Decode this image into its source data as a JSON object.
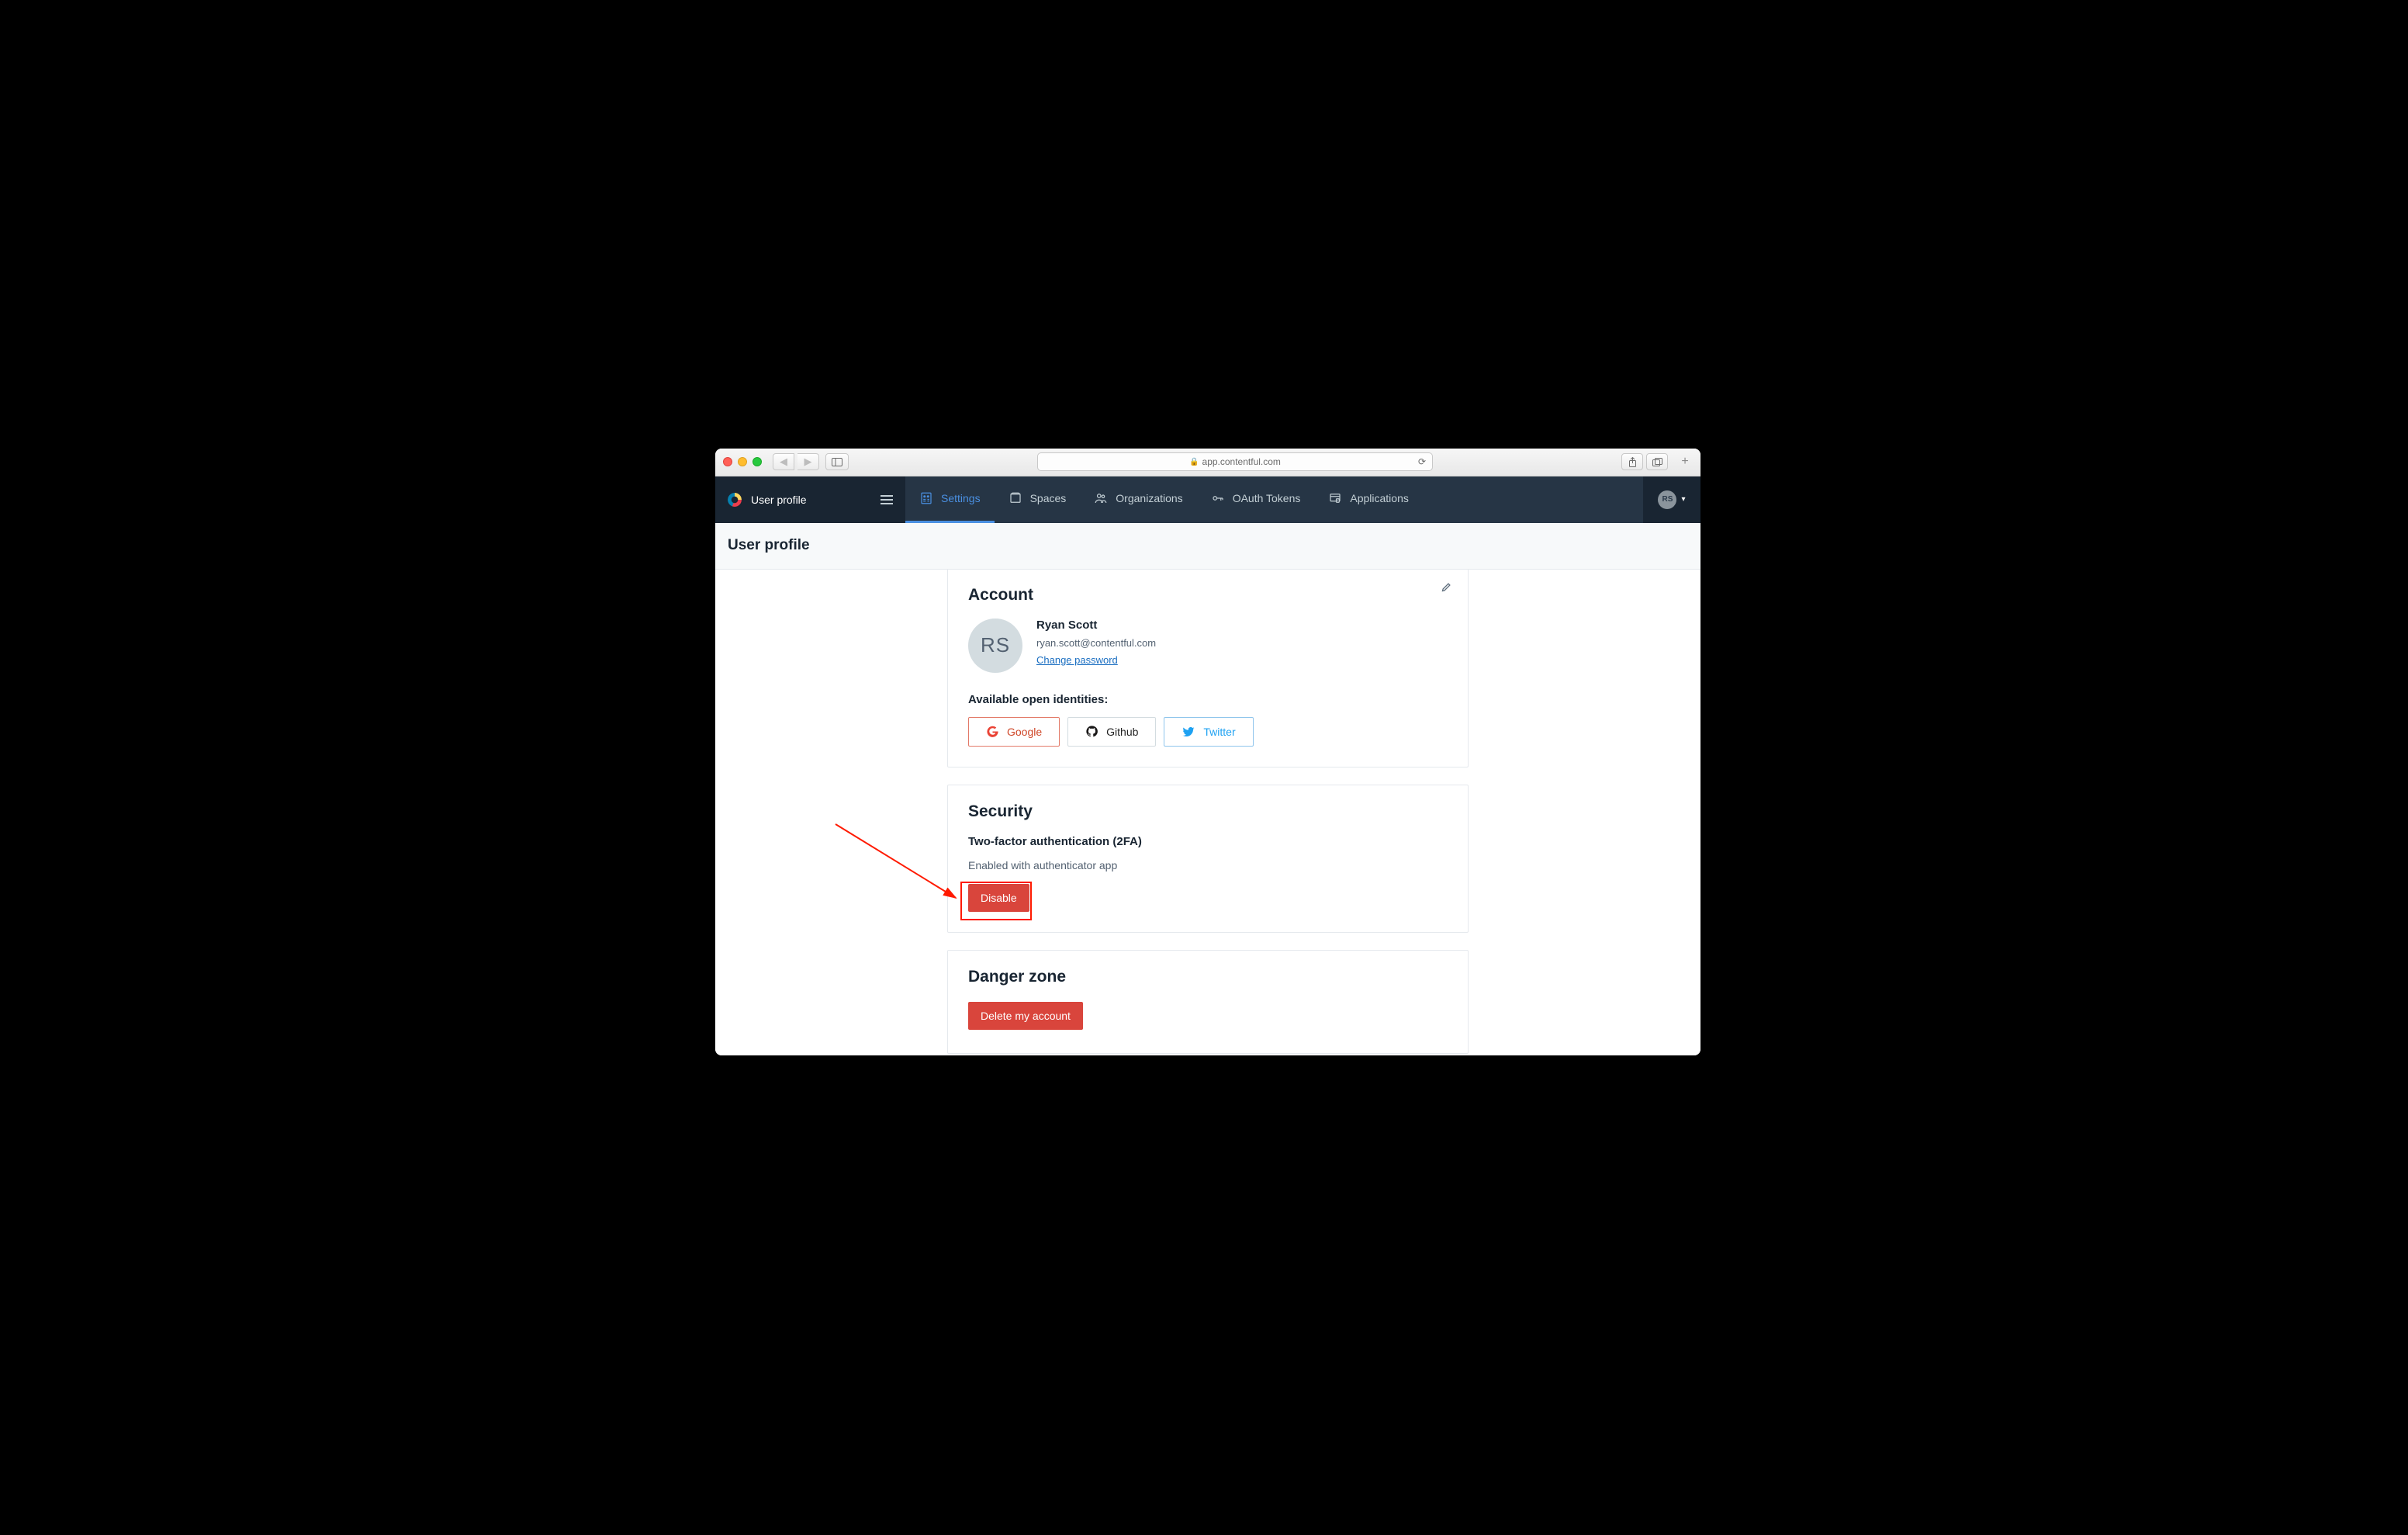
{
  "browser": {
    "url_host": "app.contentful.com"
  },
  "nav": {
    "brand_title": "User profile",
    "items": [
      {
        "label": "Settings",
        "active": true
      },
      {
        "label": "Spaces",
        "active": false
      },
      {
        "label": "Organizations",
        "active": false
      },
      {
        "label": "OAuth Tokens",
        "active": false
      },
      {
        "label": "Applications",
        "active": false
      }
    ],
    "avatar_initials": "RS"
  },
  "page": {
    "title": "User profile"
  },
  "account": {
    "section_title": "Account",
    "avatar_initials": "RS",
    "name": "Ryan Scott",
    "email": "ryan.scott@contentful.com",
    "change_password": "Change password",
    "identities_title": "Available open identities:",
    "identities": {
      "google": "Google",
      "github": "Github",
      "twitter": "Twitter"
    }
  },
  "security": {
    "section_title": "Security",
    "twofa_title": "Two-factor authentication (2FA)",
    "twofa_status": "Enabled with authenticator app",
    "disable_label": "Disable"
  },
  "danger": {
    "section_title": "Danger zone",
    "delete_label": "Delete my account"
  }
}
